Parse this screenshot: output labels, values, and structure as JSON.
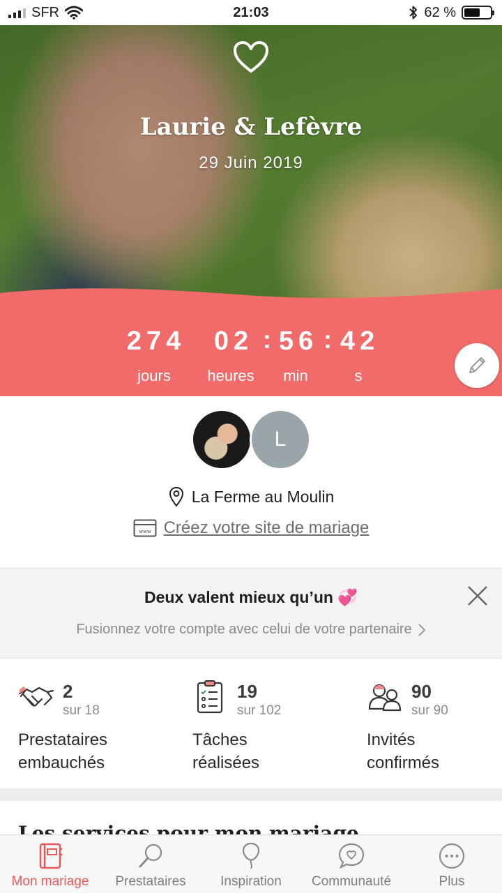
{
  "status_bar": {
    "carrier": "SFR",
    "time": "21:03",
    "battery": "62 %",
    "battery_level": 0.62
  },
  "hero": {
    "names": "Laurie & Lefèvre",
    "date": "29 Juin 2019"
  },
  "countdown": {
    "days": "274",
    "days_label": "jours",
    "hours": "02",
    "hours_label": "heures",
    "minutes": "56",
    "minutes_label": "min",
    "seconds": "42",
    "seconds_label": "s",
    "separator": ":"
  },
  "profile": {
    "partner_initial": "L",
    "venue": "La Ferme au Moulin",
    "site_link": "Créez votre site de mariage"
  },
  "banner": {
    "title": "Deux valent mieux qu’un 💞",
    "subtitle": "Fusionnez votre compte avec celui de votre partenaire"
  },
  "stats": [
    {
      "value": "2",
      "of": "sur 18",
      "label_line1": "Prestataires",
      "label_line2": "embauchés"
    },
    {
      "value": "19",
      "of": "sur 102",
      "label_line1": "Tâches",
      "label_line2": "réalisées"
    },
    {
      "value": "90",
      "of": "sur 90",
      "label_line1": "Invités",
      "label_line2": "confirmés"
    }
  ],
  "services_title": "Les services pour mon mariage",
  "tabs": [
    {
      "label": "Mon mariage",
      "icon": "notebook-icon",
      "active": true
    },
    {
      "label": "Prestataires",
      "icon": "search-icon",
      "active": false
    },
    {
      "label": "Inspiration",
      "icon": "balloon-icon",
      "active": false
    },
    {
      "label": "Communauté",
      "icon": "chat-heart-icon",
      "active": false
    },
    {
      "label": "Plus",
      "icon": "more-icon",
      "active": false
    }
  ],
  "colors": {
    "accent": "#f16b6b",
    "tab_active": "#e85a5a",
    "text_muted": "#8a8a8a"
  }
}
